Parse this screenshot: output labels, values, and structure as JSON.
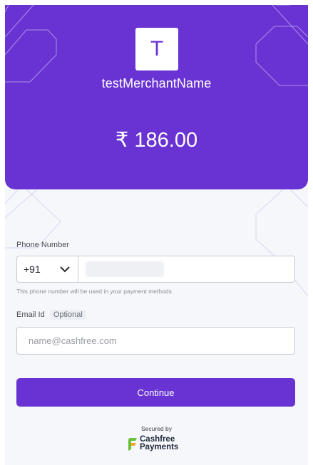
{
  "merchant": {
    "logo_letter": "T",
    "name": "testMerchantName",
    "amount": "₹ 186.00"
  },
  "form": {
    "phone_label": "Phone Number",
    "country_code": "+91",
    "phone_hint": "This phone number will be used in your payment methods",
    "email_label": "Email Id",
    "email_optional": "Optional",
    "email_placeholder": "name@cashfree.com",
    "continue_label": "Continue"
  },
  "footer": {
    "secured_by": "Secured by",
    "brand_line1": "Cashfree",
    "brand_line2": "Payments"
  },
  "colors": {
    "brand": "#6933d3",
    "background": "#f6f7fb"
  },
  "icons": {
    "country_dropdown": "chevron-down-icon",
    "brand_logo": "cashfree-logo-icon"
  }
}
